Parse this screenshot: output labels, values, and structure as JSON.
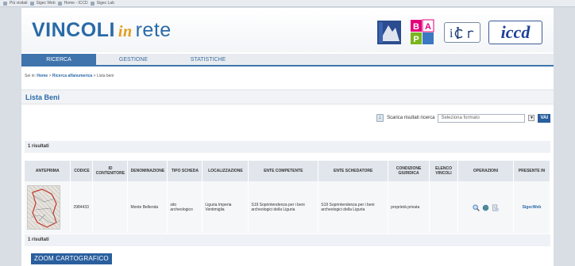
{
  "browser": {
    "favorites_label": "Più visitati",
    "bookmarks": [
      "Sigec Web",
      "Home - ICCD",
      "Sigec Lab"
    ]
  },
  "header": {
    "brand_part1": "VINCOLI",
    "brand_part2": "in",
    "brand_part3": "rete",
    "logo_mibac_text": "MIBAC",
    "logo_bap_text": "BAP",
    "logo_icr_text": "i",
    "logo_iccd_text": "iccd"
  },
  "nav": {
    "tabs": [
      {
        "label": "RICERCA",
        "active": true
      },
      {
        "label": "GESTIONE",
        "active": false
      },
      {
        "label": "STATISTICHE",
        "active": false
      }
    ]
  },
  "breadcrumb": {
    "prefix": "Sei in:",
    "home": "Home",
    "sep1": ">",
    "search": "Ricerca alfanumerica",
    "sep2": ">",
    "current": "Lista beni"
  },
  "section": {
    "title": "Lista Beni"
  },
  "download": {
    "label": "Scarica risultati ricerca",
    "select_value": "Seleziona formato",
    "go_label": "VAI"
  },
  "results": {
    "count_text_top": "1 risultati",
    "count_text_bottom": "1 risultati"
  },
  "table": {
    "headers": [
      "ANTEPRIMA",
      "CODICE",
      "ID CONTENITORE",
      "DENOMINAZIONE",
      "TIPO SCHEDA",
      "LOCALIZZAZIONE",
      "ENTE COMPETENTE",
      "ENTE SCHEDATORE",
      "CONDIZIONE GIURIDICA",
      "ELENCO VINCOLI",
      "OPERAZIONI",
      "PRESENTE IN"
    ],
    "rows": [
      {
        "codice": "2984433",
        "id_contenitore": "",
        "denominazione": "Monte Bellenda",
        "tipo_scheda": "sito archeologico",
        "localizzazione": "Liguria Imperia Ventimiglia",
        "ente_competente": "S19 Soprintendenza per i beni archeologici della Liguria",
        "ente_schedatore": "S19 Soprintendenza per i beni archeologici della Liguria",
        "condizione_giuridica": "proprietà privata",
        "elenco_vincoli": "",
        "operazioni_icons": [
          "magnifier-icon",
          "globe-icon",
          "document-icon"
        ],
        "presente_in": "SigecWeb"
      }
    ]
  },
  "footer": {
    "zoom_label": "ZOOM CARTOGRAFICO"
  },
  "colors": {
    "brand_blue": "#2a6aa8",
    "accent_orange": "#e39b1b",
    "nav_active": "#3f74ad",
    "button_blue": "#2a5f9e"
  }
}
